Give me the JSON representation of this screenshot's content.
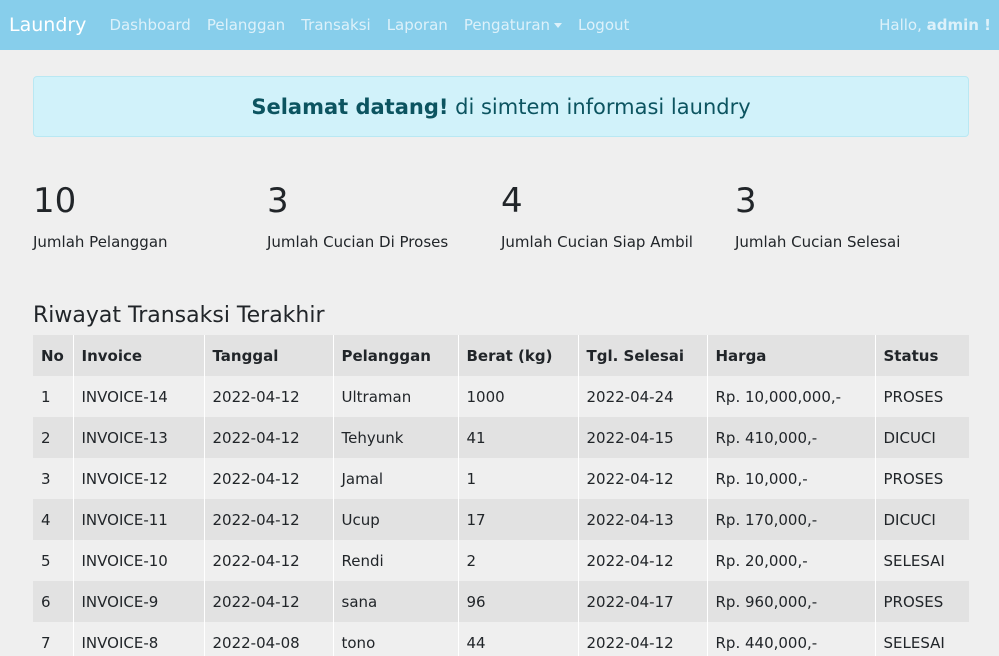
{
  "navbar": {
    "brand": "Laundry",
    "links": [
      "Dashboard",
      "Pelanggan",
      "Transaksi",
      "Laporan",
      "Pengaturan",
      "Logout"
    ],
    "greeting_prefix": "Hallo, ",
    "greeting_user": "admin !"
  },
  "alert": {
    "bold": "Selamat datang!",
    "text": " di simtem informasi laundry"
  },
  "stats": [
    {
      "value": "10",
      "label": "Jumlah Pelanggan"
    },
    {
      "value": "3",
      "label": "Jumlah Cucian Di Proses"
    },
    {
      "value": "4",
      "label": "Jumlah Cucian Siap Ambil"
    },
    {
      "value": "3",
      "label": "Jumlah Cucian Selesai"
    }
  ],
  "table": {
    "title": "Riwayat Transaksi Terakhir",
    "headers": [
      "No",
      "Invoice",
      "Tanggal",
      "Pelanggan",
      "Berat (kg)",
      "Tgl. Selesai",
      "Harga",
      "Status"
    ],
    "rows": [
      [
        "1",
        "INVOICE-14",
        "2022-04-12",
        "Ultraman",
        "1000",
        "2022-04-24",
        "Rp. 10,000,000,-",
        "PROSES"
      ],
      [
        "2",
        "INVOICE-13",
        "2022-04-12",
        "Tehyunk",
        "41",
        "2022-04-15",
        "Rp. 410,000,-",
        "DICUCI"
      ],
      [
        "3",
        "INVOICE-12",
        "2022-04-12",
        "Jamal",
        "1",
        "2022-04-12",
        "Rp. 10,000,-",
        "PROSES"
      ],
      [
        "4",
        "INVOICE-11",
        "2022-04-12",
        "Ucup",
        "17",
        "2022-04-13",
        "Rp. 170,000,-",
        "DICUCI"
      ],
      [
        "5",
        "INVOICE-10",
        "2022-04-12",
        "Rendi",
        "2",
        "2022-04-12",
        "Rp. 20,000,-",
        "SELESAI"
      ],
      [
        "6",
        "INVOICE-9",
        "2022-04-12",
        "sana",
        "96",
        "2022-04-17",
        "Rp. 960,000,-",
        "PROSES"
      ],
      [
        "7",
        "INVOICE-8",
        "2022-04-08",
        "tono",
        "44",
        "2022-04-12",
        "Rp. 440,000,-",
        "SELESAI"
      ]
    ]
  }
}
